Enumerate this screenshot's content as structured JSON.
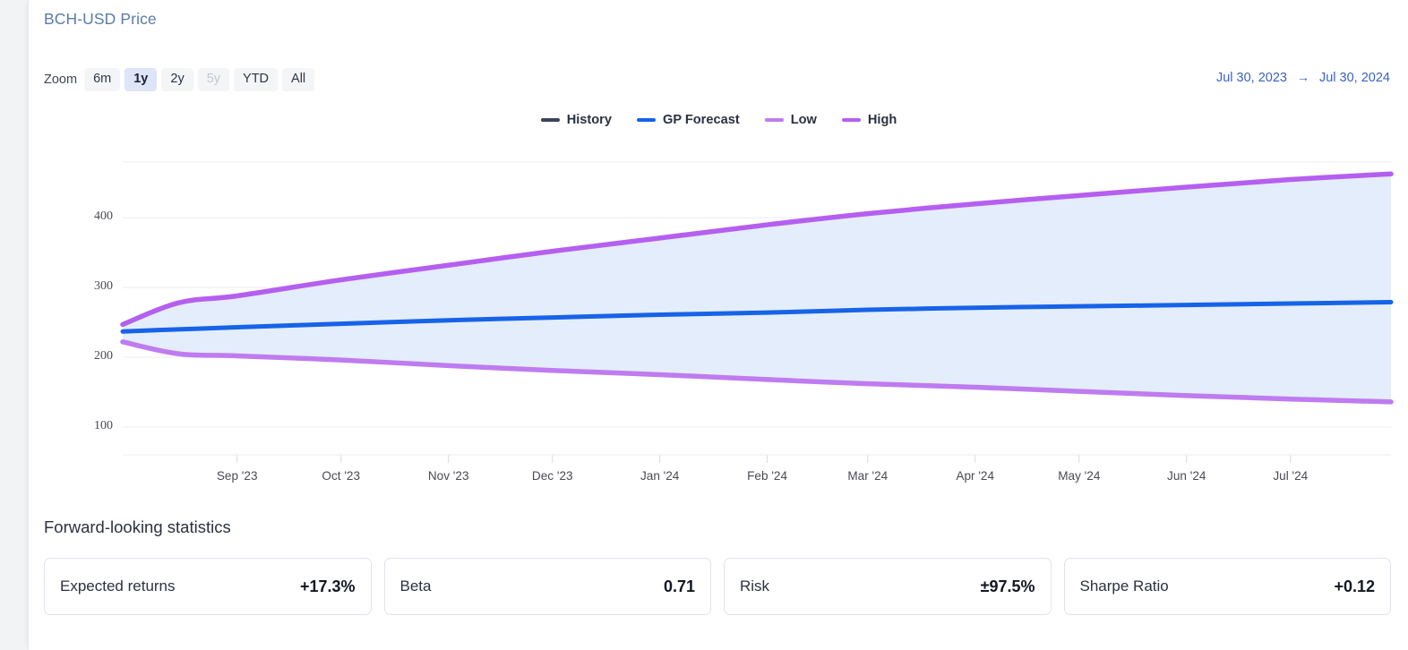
{
  "chart_title": "BCH-USD Price",
  "zoom": {
    "label": "Zoom",
    "buttons": [
      {
        "label": "6m",
        "state": "normal"
      },
      {
        "label": "1y",
        "state": "active"
      },
      {
        "label": "2y",
        "state": "normal"
      },
      {
        "label": "5y",
        "state": "disabled"
      },
      {
        "label": "YTD",
        "state": "normal"
      },
      {
        "label": "All",
        "state": "normal"
      }
    ]
  },
  "date_range": {
    "start": "Jul 30, 2023",
    "arrow": "→",
    "end": "Jul 30, 2024"
  },
  "legend": [
    {
      "label": "History",
      "color": "#3c4456"
    },
    {
      "label": "GP Forecast",
      "color": "#1763e8"
    },
    {
      "label": "Low",
      "color": "#bf7bf0"
    },
    {
      "label": "High",
      "color": "#b55ff0"
    }
  ],
  "statistics": {
    "title": "Forward-looking statistics",
    "cards": [
      {
        "label": "Expected returns",
        "value": "+17.3%"
      },
      {
        "label": "Beta",
        "value": "0.71"
      },
      {
        "label": "Risk",
        "value": "±97.5%"
      },
      {
        "label": "Sharpe Ratio",
        "value": "+0.12"
      }
    ]
  },
  "colors": {
    "history": "#3c4456",
    "forecast": "#1763e8",
    "band_line": "#b168ef",
    "band_fill": "#e4edfb",
    "gridline": "#eceef1",
    "axis_text": "#4a4a52",
    "link": "#3a61c4",
    "title": "#5b7ba8"
  },
  "chart_data": {
    "type": "line",
    "title": "BCH-USD Price",
    "xlabel": "",
    "ylabel": "",
    "grid": true,
    "legend_position": "top-center",
    "ylim": [
      60,
      480
    ],
    "yticks": [
      100,
      200,
      300,
      400
    ],
    "xlim": [
      "2023-07-30",
      "2024-07-30"
    ],
    "xticks": [
      "Sep '23",
      "Oct '23",
      "Nov '23",
      "Dec '23",
      "Jan '24",
      "Feb '24",
      "Mar '24",
      "Apr '24",
      "May '24",
      "Jun '24",
      "Jul '24"
    ],
    "x": [
      "2023-07-30",
      "2023-08-15",
      "2023-09-01",
      "2023-10-01",
      "2023-11-01",
      "2023-12-01",
      "2024-01-01",
      "2024-02-01",
      "2024-03-01",
      "2024-04-01",
      "2024-05-01",
      "2024-06-01",
      "2024-07-01",
      "2024-07-30"
    ],
    "series": [
      {
        "name": "History",
        "color": "#3c4456",
        "values": [
          237,
          null,
          null,
          null,
          null,
          null,
          null,
          null,
          null,
          null,
          null,
          null,
          null,
          null
        ]
      },
      {
        "name": "GP Forecast",
        "color": "#1763e8",
        "values": [
          237,
          240,
          243,
          248,
          253,
          257,
          261,
          264,
          268,
          271,
          273,
          275,
          277,
          279
        ]
      },
      {
        "name": "Low",
        "color": "#bf7bf0",
        "values": [
          222,
          205,
          202,
          196,
          188,
          181,
          175,
          168,
          162,
          157,
          151,
          145,
          140,
          136
        ]
      },
      {
        "name": "High",
        "color": "#b55ff0",
        "values": [
          247,
          278,
          288,
          311,
          332,
          352,
          371,
          390,
          406,
          420,
          432,
          444,
          455,
          463
        ]
      }
    ]
  }
}
